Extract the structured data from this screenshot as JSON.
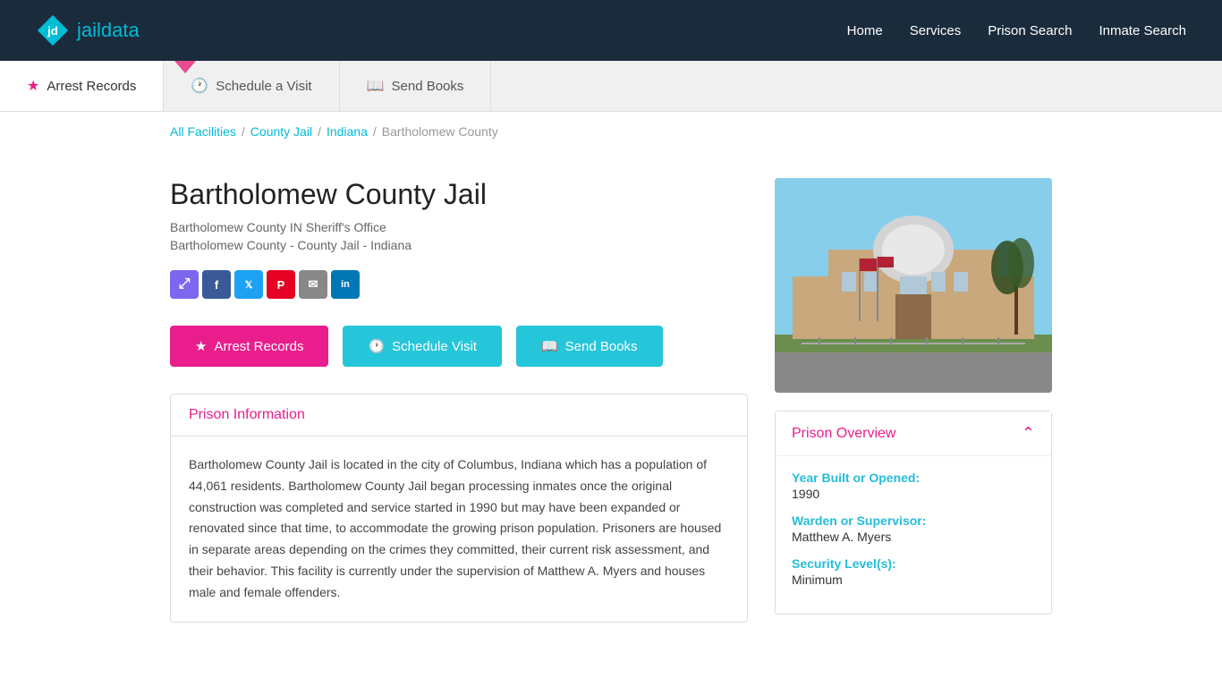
{
  "header": {
    "logo_text_jd": "jd",
    "logo_text_jail": "jail",
    "logo_text_data": "data",
    "nav": [
      {
        "label": "Home",
        "id": "home"
      },
      {
        "label": "Services",
        "id": "services"
      },
      {
        "label": "Prison Search",
        "id": "prison-search"
      },
      {
        "label": "Inmate Search",
        "id": "inmate-search"
      }
    ]
  },
  "subnav": [
    {
      "label": "Arrest Records",
      "icon": "star",
      "active": true
    },
    {
      "label": "Schedule a Visit",
      "icon": "clock"
    },
    {
      "label": "Send Books",
      "icon": "book"
    }
  ],
  "breadcrumb": {
    "items": [
      {
        "label": "All Facilities",
        "link": true
      },
      {
        "label": "County Jail",
        "link": true
      },
      {
        "label": "Indiana",
        "link": true
      },
      {
        "label": "Bartholomew County",
        "link": false
      }
    ],
    "separator": "/"
  },
  "page": {
    "title": "Bartholomew County Jail",
    "subtitle1": "Bartholomew County IN Sheriff's Office",
    "subtitle2": "Bartholomew County - County Jail - Indiana"
  },
  "social": {
    "share_symbol": "⤢",
    "fb": "f",
    "tw": "t",
    "pin": "P",
    "em": "✉",
    "li": "in"
  },
  "action_buttons": {
    "arrest_records": "Arrest Records",
    "schedule_visit": "Schedule Visit",
    "send_books": "Send Books"
  },
  "prison_info": {
    "header": "Prison Information",
    "body": "Bartholomew County Jail is located in the city of Columbus, Indiana which has a population of 44,061 residents. Bartholomew County Jail began processing inmates once the original construction was completed and service started in 1990 but may have been expanded or renovated since that time, to accommodate the growing prison population. Prisoners are housed in separate areas depending on the crimes they committed, their current risk assessment, and their behavior. This facility is currently under the supervision of Matthew A. Myers and houses male and female offenders."
  },
  "prison_overview": {
    "header": "Prison Overview",
    "year_label": "Year Built or Opened:",
    "year_value": "1990",
    "warden_label": "Warden or Supervisor:",
    "warden_value": "Matthew A. Myers",
    "security_label": "Security Level(s):",
    "security_value": "Minimum"
  }
}
